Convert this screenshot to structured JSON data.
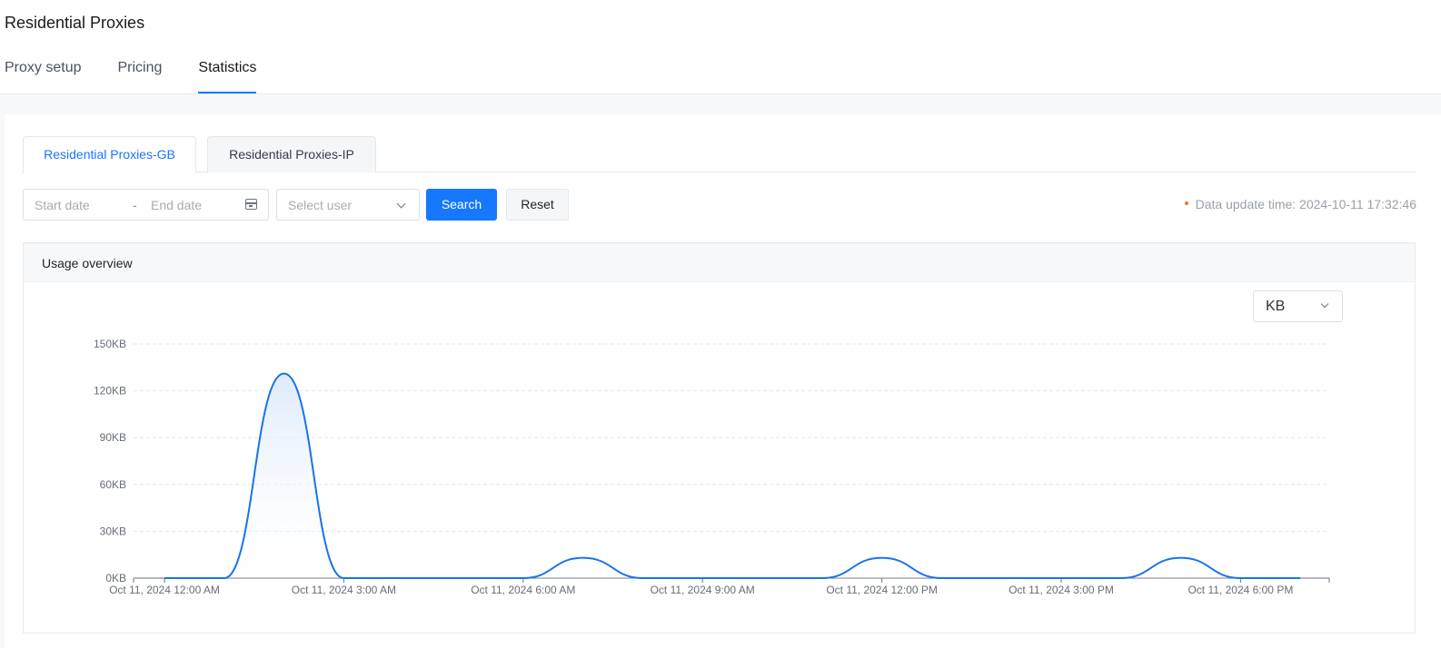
{
  "header": {
    "title": "Residential Proxies",
    "tabs": [
      {
        "label": "Proxy setup",
        "active": false
      },
      {
        "label": "Pricing",
        "active": false
      },
      {
        "label": "Statistics",
        "active": true
      }
    ]
  },
  "sub_tabs": [
    {
      "label": "Residential Proxies-GB",
      "active": true
    },
    {
      "label": "Residential Proxies-IP",
      "active": false
    }
  ],
  "filters": {
    "start_placeholder": "Start date",
    "separator": "-",
    "end_placeholder": "End date",
    "user_placeholder": "Select user",
    "search_label": "Search",
    "reset_label": "Reset",
    "update_time": "Data update time: 2024-10-11 17:32:46"
  },
  "card": {
    "title": "Usage overview",
    "unit": "KB"
  },
  "colors": {
    "accent": "#1677ff",
    "dot": "#f56c2d",
    "line": "#1a73e8"
  },
  "chart_data": {
    "type": "area",
    "x_tick_labels": [
      "Oct 11, 2024 12:00 AM",
      "Oct 11, 2024 3:00 AM",
      "Oct 11, 2024 6:00 AM",
      "Oct 11, 2024 9:00 AM",
      "Oct 11, 2024 12:00 PM",
      "Oct 11, 2024 3:00 PM",
      "Oct 11, 2024 6:00 PM"
    ],
    "y_tick_labels": [
      "0KB",
      "30KB",
      "60KB",
      "90KB",
      "120KB",
      "150KB"
    ],
    "ylim": [
      0,
      150
    ],
    "x_hours": [
      0,
      1,
      2,
      3,
      4,
      5,
      6,
      7,
      8,
      9,
      10,
      11,
      12,
      13,
      14,
      15,
      16,
      17,
      18,
      19
    ],
    "values_kb": [
      0,
      0,
      131,
      0,
      0,
      0,
      0,
      13,
      0,
      0,
      0,
      0,
      13,
      0,
      0,
      0,
      0,
      13,
      0,
      0
    ],
    "grid": true
  }
}
